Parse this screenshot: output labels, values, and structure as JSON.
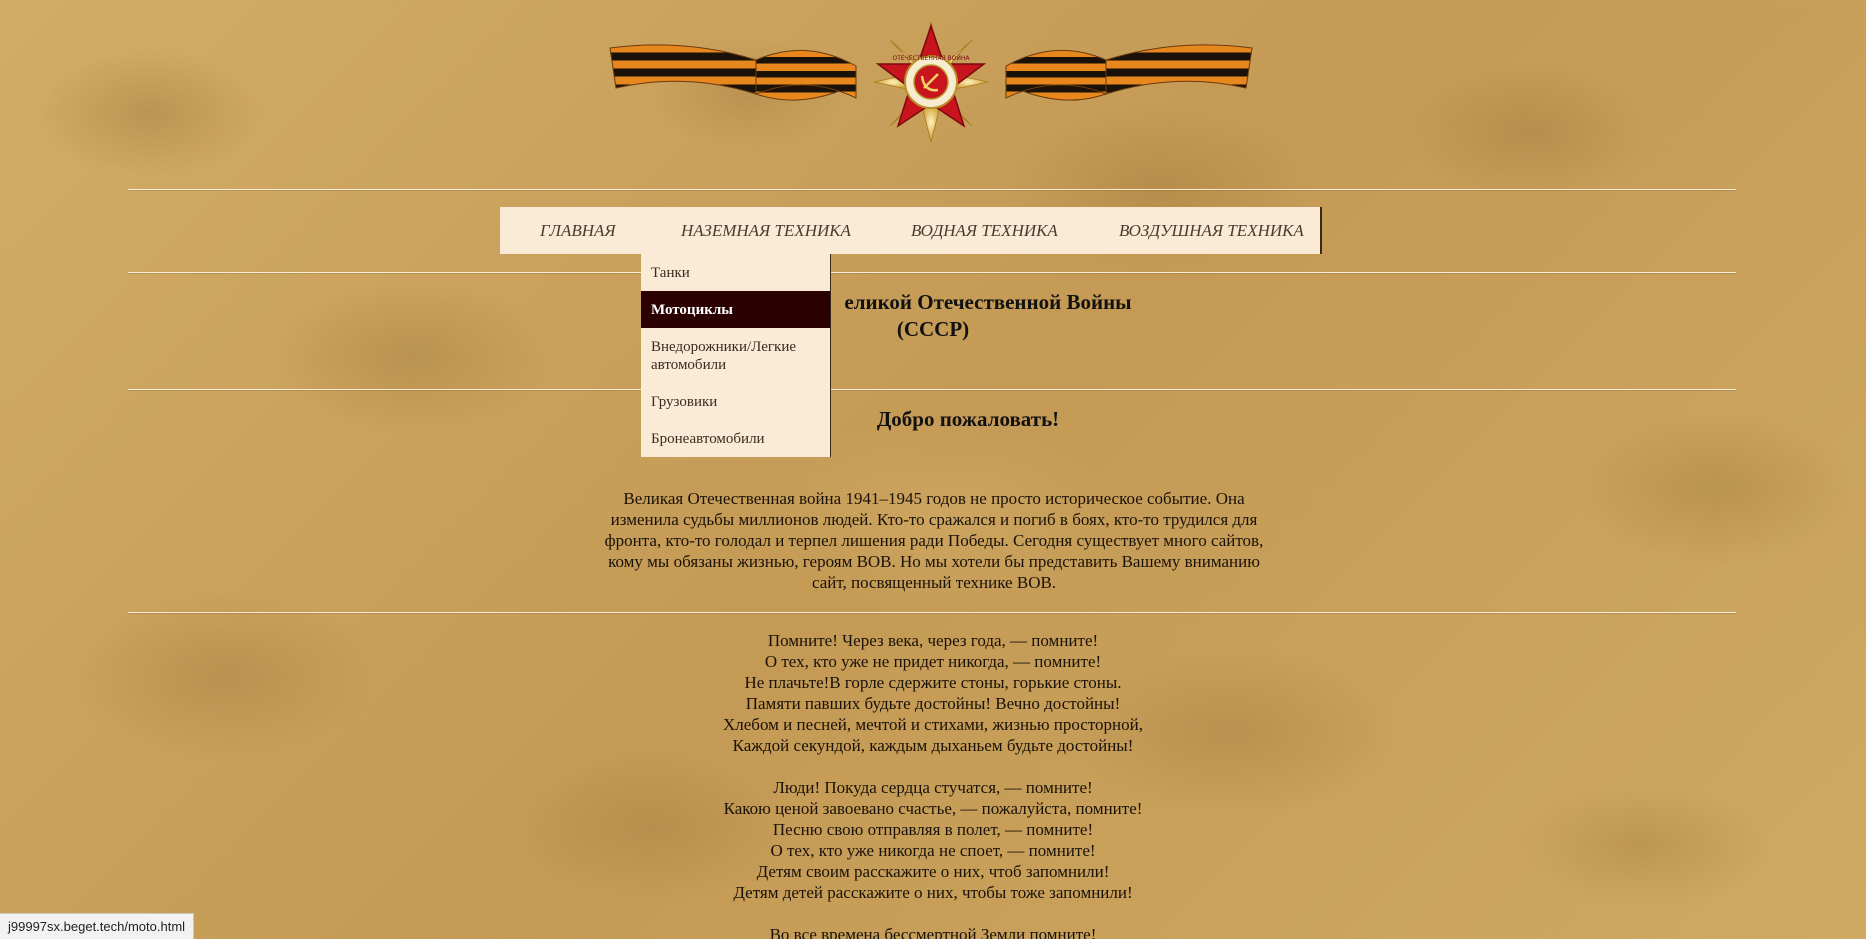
{
  "nav": {
    "items": [
      {
        "label": "ГЛАВНАЯ"
      },
      {
        "label": "НАЗЕМНАЯ ТЕХНИКА"
      },
      {
        "label": "ВОДНАЯ ТЕХНИКА"
      },
      {
        "label": "ВОЗДУШНАЯ ТЕХНИКА"
      }
    ]
  },
  "dropdown": {
    "items": [
      {
        "label": "Танки"
      },
      {
        "label": "Мотоциклы"
      },
      {
        "label": "Внедорожники/Легкие автомобили"
      },
      {
        "label": "Грузовики"
      },
      {
        "label": "Бронеавтомобили"
      }
    ],
    "active_index": 1
  },
  "title": {
    "line1_visible": "еликой Отечественной Войны",
    "line2": "(СССР)"
  },
  "welcome": "Добро пожаловать!",
  "intro": "Великая Отечественная война 1941–1945 годов не просто историческое событие. Она изменила судьбы миллионов людей. Кто-то сражался и погиб в боях, кто-то трудился для фронта, кто-то голодал и терпел лишения ради Победы. Сегодня существует много сайтов, кому мы обязаны жизнью, героям ВОВ. Но мы хотели бы представить Вашему вниманию сайт, посвященный технике ВОВ.",
  "poem": {
    "stanza1": [
      "Помните! Через века, через года, — помните!",
      "О тех, кто уже не придет никогда, — помните!",
      "Не плачьте!В горле сдержите стоны, горькие стоны.",
      "Памяти павших будьте достойны! Вечно достойны!",
      "Хлебом и песней, мечтой и стихами, жизнью просторной,",
      "Каждой секундой, каждым дыханьем будьте достойны!"
    ],
    "stanza2": [
      "Люди! Покуда сердца стучатся, — помните!",
      "Какою ценой завоевано счастье, — пожалуйста, помните!",
      "Песню свою отправляя в полет, — помните!",
      "О тех, кто уже никогда не споет, — помните!",
      "Детям своим расскажите о них, чтоб запомнили!",
      "Детям детей расскажите о них, чтобы тоже запомнили!"
    ],
    "stanza3": [
      "Во все времена бессмертной Земли помните!"
    ]
  },
  "emblem": {
    "ring_text": "ОТЕЧЕСТВЕННАЯ ВОЙНА",
    "colors": {
      "star": "#c8141c",
      "ribbon_orange": "#e8871e",
      "ribbon_black": "#1a1208",
      "gold": "#e0b84a"
    }
  },
  "status_bar": {
    "url": "j99997sx.beget.tech/moto.html"
  }
}
